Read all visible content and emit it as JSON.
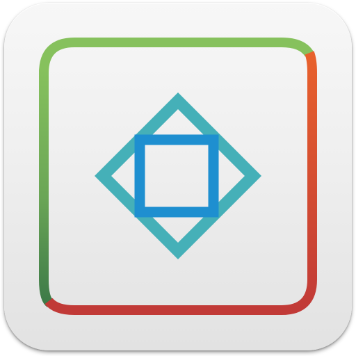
{
  "app_icon": {
    "icon_name": "square-diamond-frame-icon",
    "colors": {
      "tile_top": "#f7f7f7",
      "tile_bottom": "#e2e2e2",
      "frame_green_light": "#86c15d",
      "frame_green_dark": "#3d7a48",
      "frame_orange": "#e8612c",
      "frame_red": "#c13a37",
      "diamond_teal": "#45b0b8",
      "inner_square_blue": "#1e8fd0"
    }
  }
}
